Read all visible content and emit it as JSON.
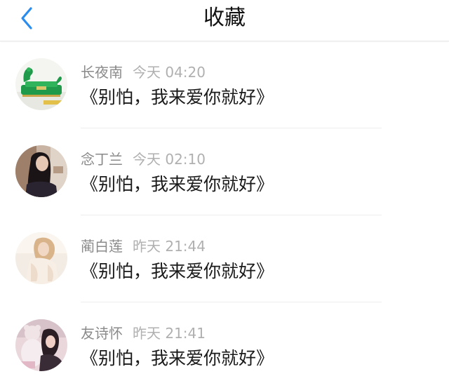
{
  "header": {
    "title": "收藏",
    "back_icon": "chevron-left-icon",
    "accent_color": "#2b8cf0"
  },
  "items": [
    {
      "name": "长夜南",
      "time": "今天 04:20",
      "content": "《别怕，我来爱你就好》"
    },
    {
      "name": "念丁兰",
      "time": "今天 02:10",
      "content": "《别怕，我来爱你就好》"
    },
    {
      "name": "蔺白莲",
      "time": "昨天 21:44",
      "content": "《别怕，我来爱你就好》"
    },
    {
      "name": "友诗怀",
      "time": "昨天 21:41",
      "content": "《别怕，我来爱你就好》"
    }
  ]
}
